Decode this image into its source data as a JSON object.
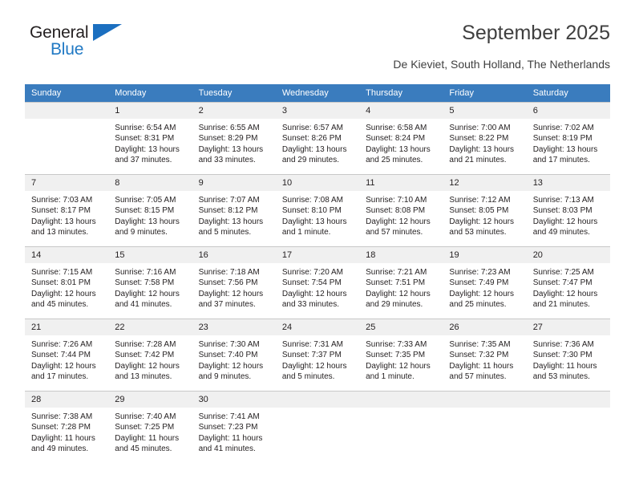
{
  "brand": {
    "name_top": "General",
    "name_bottom": "Blue",
    "triangle_color": "#1b6fc0",
    "text_color": "#231f20",
    "blue_color": "#2079c4"
  },
  "header": {
    "title": "September 2025",
    "subtitle": "De Kieviet, South Holland, The Netherlands"
  },
  "colors": {
    "header_row_bg": "#3a7cbe",
    "daynum_bg": "#f0f0f0",
    "cell_border": "#c8c8c8",
    "text": "#231f20"
  },
  "weekdays": [
    "Sunday",
    "Monday",
    "Tuesday",
    "Wednesday",
    "Thursday",
    "Friday",
    "Saturday"
  ],
  "weeks": [
    [
      {
        "day": "",
        "lines": []
      },
      {
        "day": "1",
        "lines": [
          "Sunrise: 6:54 AM",
          "Sunset: 8:31 PM",
          "Daylight: 13 hours",
          "and 37 minutes."
        ]
      },
      {
        "day": "2",
        "lines": [
          "Sunrise: 6:55 AM",
          "Sunset: 8:29 PM",
          "Daylight: 13 hours",
          "and 33 minutes."
        ]
      },
      {
        "day": "3",
        "lines": [
          "Sunrise: 6:57 AM",
          "Sunset: 8:26 PM",
          "Daylight: 13 hours",
          "and 29 minutes."
        ]
      },
      {
        "day": "4",
        "lines": [
          "Sunrise: 6:58 AM",
          "Sunset: 8:24 PM",
          "Daylight: 13 hours",
          "and 25 minutes."
        ]
      },
      {
        "day": "5",
        "lines": [
          "Sunrise: 7:00 AM",
          "Sunset: 8:22 PM",
          "Daylight: 13 hours",
          "and 21 minutes."
        ]
      },
      {
        "day": "6",
        "lines": [
          "Sunrise: 7:02 AM",
          "Sunset: 8:19 PM",
          "Daylight: 13 hours",
          "and 17 minutes."
        ]
      }
    ],
    [
      {
        "day": "7",
        "lines": [
          "Sunrise: 7:03 AM",
          "Sunset: 8:17 PM",
          "Daylight: 13 hours",
          "and 13 minutes."
        ]
      },
      {
        "day": "8",
        "lines": [
          "Sunrise: 7:05 AM",
          "Sunset: 8:15 PM",
          "Daylight: 13 hours",
          "and 9 minutes."
        ]
      },
      {
        "day": "9",
        "lines": [
          "Sunrise: 7:07 AM",
          "Sunset: 8:12 PM",
          "Daylight: 13 hours",
          "and 5 minutes."
        ]
      },
      {
        "day": "10",
        "lines": [
          "Sunrise: 7:08 AM",
          "Sunset: 8:10 PM",
          "Daylight: 13 hours",
          "and 1 minute."
        ]
      },
      {
        "day": "11",
        "lines": [
          "Sunrise: 7:10 AM",
          "Sunset: 8:08 PM",
          "Daylight: 12 hours",
          "and 57 minutes."
        ]
      },
      {
        "day": "12",
        "lines": [
          "Sunrise: 7:12 AM",
          "Sunset: 8:05 PM",
          "Daylight: 12 hours",
          "and 53 minutes."
        ]
      },
      {
        "day": "13",
        "lines": [
          "Sunrise: 7:13 AM",
          "Sunset: 8:03 PM",
          "Daylight: 12 hours",
          "and 49 minutes."
        ]
      }
    ],
    [
      {
        "day": "14",
        "lines": [
          "Sunrise: 7:15 AM",
          "Sunset: 8:01 PM",
          "Daylight: 12 hours",
          "and 45 minutes."
        ]
      },
      {
        "day": "15",
        "lines": [
          "Sunrise: 7:16 AM",
          "Sunset: 7:58 PM",
          "Daylight: 12 hours",
          "and 41 minutes."
        ]
      },
      {
        "day": "16",
        "lines": [
          "Sunrise: 7:18 AM",
          "Sunset: 7:56 PM",
          "Daylight: 12 hours",
          "and 37 minutes."
        ]
      },
      {
        "day": "17",
        "lines": [
          "Sunrise: 7:20 AM",
          "Sunset: 7:54 PM",
          "Daylight: 12 hours",
          "and 33 minutes."
        ]
      },
      {
        "day": "18",
        "lines": [
          "Sunrise: 7:21 AM",
          "Sunset: 7:51 PM",
          "Daylight: 12 hours",
          "and 29 minutes."
        ]
      },
      {
        "day": "19",
        "lines": [
          "Sunrise: 7:23 AM",
          "Sunset: 7:49 PM",
          "Daylight: 12 hours",
          "and 25 minutes."
        ]
      },
      {
        "day": "20",
        "lines": [
          "Sunrise: 7:25 AM",
          "Sunset: 7:47 PM",
          "Daylight: 12 hours",
          "and 21 minutes."
        ]
      }
    ],
    [
      {
        "day": "21",
        "lines": [
          "Sunrise: 7:26 AM",
          "Sunset: 7:44 PM",
          "Daylight: 12 hours",
          "and 17 minutes."
        ]
      },
      {
        "day": "22",
        "lines": [
          "Sunrise: 7:28 AM",
          "Sunset: 7:42 PM",
          "Daylight: 12 hours",
          "and 13 minutes."
        ]
      },
      {
        "day": "23",
        "lines": [
          "Sunrise: 7:30 AM",
          "Sunset: 7:40 PM",
          "Daylight: 12 hours",
          "and 9 minutes."
        ]
      },
      {
        "day": "24",
        "lines": [
          "Sunrise: 7:31 AM",
          "Sunset: 7:37 PM",
          "Daylight: 12 hours",
          "and 5 minutes."
        ]
      },
      {
        "day": "25",
        "lines": [
          "Sunrise: 7:33 AM",
          "Sunset: 7:35 PM",
          "Daylight: 12 hours",
          "and 1 minute."
        ]
      },
      {
        "day": "26",
        "lines": [
          "Sunrise: 7:35 AM",
          "Sunset: 7:32 PM",
          "Daylight: 11 hours",
          "and 57 minutes."
        ]
      },
      {
        "day": "27",
        "lines": [
          "Sunrise: 7:36 AM",
          "Sunset: 7:30 PM",
          "Daylight: 11 hours",
          "and 53 minutes."
        ]
      }
    ],
    [
      {
        "day": "28",
        "lines": [
          "Sunrise: 7:38 AM",
          "Sunset: 7:28 PM",
          "Daylight: 11 hours",
          "and 49 minutes."
        ]
      },
      {
        "day": "29",
        "lines": [
          "Sunrise: 7:40 AM",
          "Sunset: 7:25 PM",
          "Daylight: 11 hours",
          "and 45 minutes."
        ]
      },
      {
        "day": "30",
        "lines": [
          "Sunrise: 7:41 AM",
          "Sunset: 7:23 PM",
          "Daylight: 11 hours",
          "and 41 minutes."
        ]
      },
      {
        "day": "",
        "lines": []
      },
      {
        "day": "",
        "lines": []
      },
      {
        "day": "",
        "lines": []
      },
      {
        "day": "",
        "lines": []
      }
    ]
  ]
}
